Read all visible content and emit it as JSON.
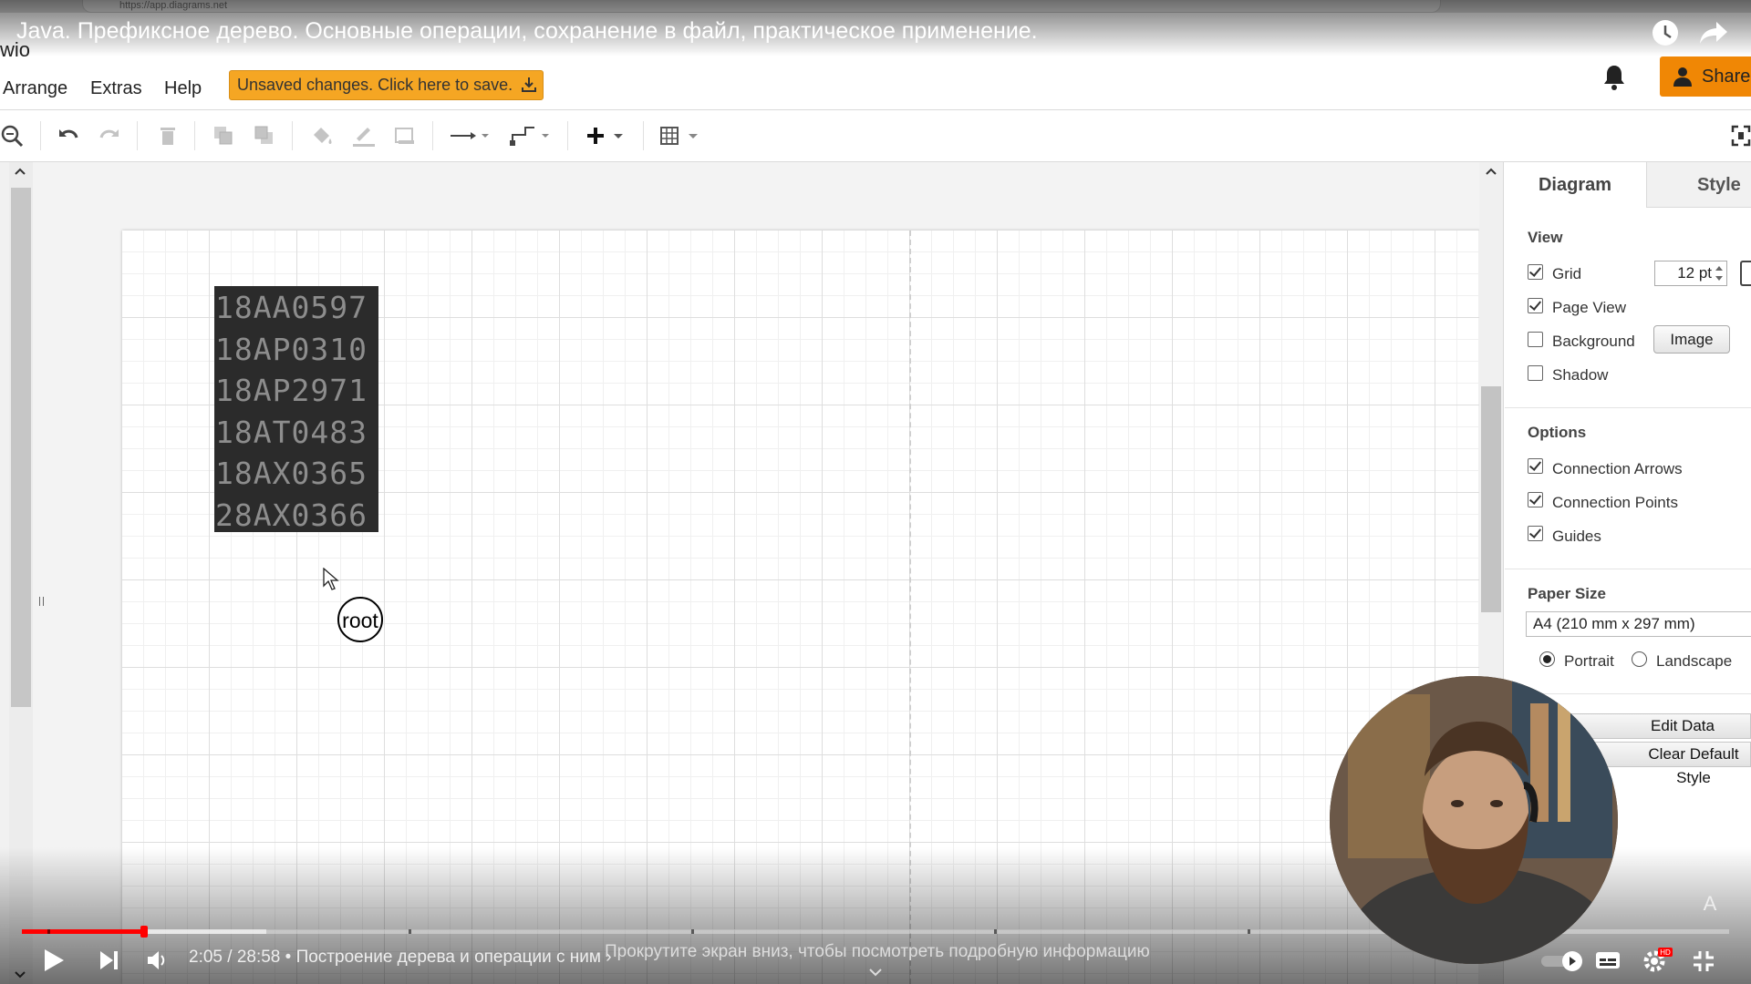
{
  "browser": {
    "url": "https://app.diagrams.net"
  },
  "app": {
    "title": "wio",
    "unsaved_label": "Unsaved changes. Click here to save.",
    "share_label": "Share"
  },
  "menu": [
    "Arrange",
    "Extras",
    "Help"
  ],
  "toolbar": {
    "icons": [
      "zoom-out-icon",
      "undo-icon",
      "redo-icon",
      "delete-icon",
      "to-front-icon",
      "to-back-icon",
      "fill-color-icon",
      "line-color-icon",
      "shadow-icon",
      "connection-icon",
      "waypoints-icon",
      "insert-icon",
      "table-icon",
      "fullscreen-icon"
    ]
  },
  "canvas": {
    "code_lines": [
      "18AA0597",
      "18AP0310",
      "18AP2971",
      "18AT0483",
      "18AX0365",
      "28AX0366"
    ],
    "root_label": "root"
  },
  "panel": {
    "tabs": [
      "Diagram",
      "Style"
    ],
    "view_title": "View",
    "view_options": [
      {
        "label": "Grid",
        "checked": true
      },
      {
        "label": "Page View",
        "checked": true
      },
      {
        "label": "Background",
        "checked": false
      },
      {
        "label": "Shadow",
        "checked": false
      }
    ],
    "grid_size": "12 pt",
    "image_button": "Image",
    "options_title": "Options",
    "options": [
      {
        "label": "Connection Arrows",
        "checked": true
      },
      {
        "label": "Connection Points",
        "checked": true
      },
      {
        "label": "Guides",
        "checked": true
      }
    ],
    "paper_title": "Paper Size",
    "paper_size": "A4 (210 mm x 297 mm)",
    "orientation": [
      {
        "label": "Portrait",
        "selected": true
      },
      {
        "label": "Landscape",
        "selected": false
      }
    ],
    "edit_data": "Edit Data",
    "clear_style": "Clear Default Style"
  },
  "video": {
    "title": "Java. Префиксное дерево. Основные операции, сохранение в файл, практическое применение.",
    "time": "2:05 / 28:58",
    "chapter": "• Построение дерева и операции с ним ›",
    "scroll_hint": "Прокрутите экран вниз, чтобы посмотреть подробную информацию",
    "progress": 0.072,
    "buffered": 0.143,
    "colors": {
      "played": "#ff0000",
      "accent": "#f08705",
      "unsaved": "#f5a623"
    }
  }
}
